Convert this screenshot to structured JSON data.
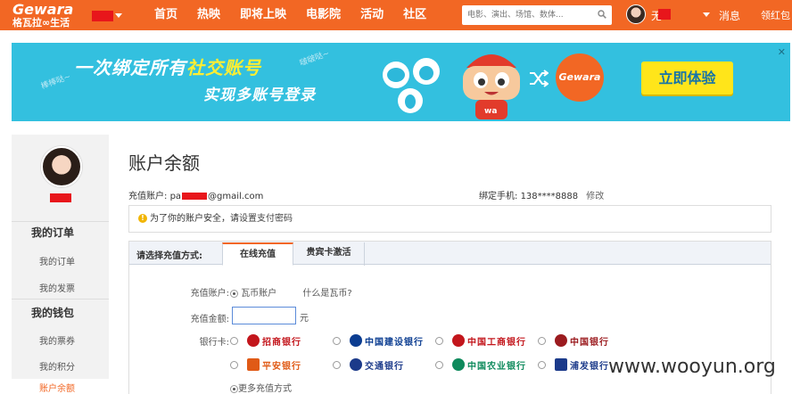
{
  "header": {
    "brand": "Gewara",
    "slogan": "格瓦拉∞生活",
    "nav": [
      "首页",
      "热映",
      "即将上映",
      "电影院",
      "活动",
      "社区"
    ],
    "search_placeholder": "电影、演出、场馆、数体...",
    "messages": "消息",
    "gift": "领红包",
    "user_initial": "无"
  },
  "banner": {
    "line1_a": "一次绑定所有",
    "line1_b": "社交账号",
    "line2": "实现多账号登录",
    "deco_left": "棒棒哒~",
    "deco_right": "啵啵哒~",
    "logo_text": "Gewara",
    "cta": "立即体验",
    "close": "✕"
  },
  "sidebar": {
    "groups": [
      {
        "label": "我的订单",
        "items": [
          "我的订单",
          "我的发票"
        ]
      },
      {
        "label": "我的钱包",
        "items": [
          "我的票券",
          "我的积分",
          "账户余额"
        ]
      }
    ],
    "active_item": "账户余额"
  },
  "main": {
    "title": "账户余额",
    "account_label": "充值账户:",
    "account_prefix": "pa",
    "account_suffix": "@gmail.com",
    "phone_label": "绑定手机:",
    "phone_value": "138****8888",
    "phone_edit": "修改",
    "notice_text": "为了你的账户安全，请",
    "notice_link": "设置支付密码",
    "pay": {
      "method_label": "请选择充值方式:",
      "tabs": [
        "在线充值",
        "贵宾卡激活"
      ],
      "active_tab": "在线充值",
      "account_row_label": "充值账户:",
      "account_option": "瓦币账户",
      "what_link": "什么是瓦币?",
      "amount_label": "充值金额:",
      "amount_value": "",
      "amount_unit": "元",
      "bank_label": "银行卡:",
      "banks_row1": [
        {
          "name": "招商银行",
          "color": "#c3161c"
        },
        {
          "name": "中国建设银行",
          "color": "#0b3d91"
        },
        {
          "name": "中国工商银行",
          "color": "#c3161c"
        },
        {
          "name": "中国银行",
          "color": "#9b1b1f"
        }
      ],
      "banks_row2": [
        {
          "name": "平安银行",
          "color": "#e05a16"
        },
        {
          "name": "交通银行",
          "color": "#1b3a8a"
        },
        {
          "name": "中国农业银行",
          "color": "#0e8a5c"
        },
        {
          "name": "浦发银行",
          "color": "#1b3a8a"
        }
      ],
      "more_methods": "更多充值方式"
    }
  },
  "watermark": "www.wooyun.org"
}
